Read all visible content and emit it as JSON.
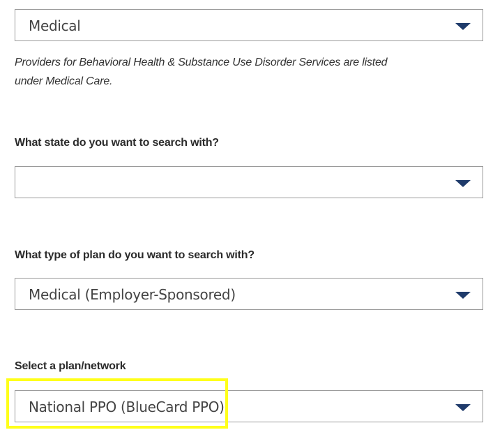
{
  "care_type": {
    "value": "Medical",
    "note": "Providers for Behavioral Health & Substance Use Disorder Services are listed under Medical Care."
  },
  "state": {
    "question": "What state do you want to search with?",
    "value": ""
  },
  "plan_type": {
    "question": "What type of plan do you want to search with?",
    "value": "Medical (Employer-Sponsored)"
  },
  "plan_network": {
    "question": "Select a plan/network",
    "value": "National PPO (BlueCard PPO)"
  },
  "colors": {
    "caret": "#1f3b6b",
    "highlight": "#ffff1a",
    "border": "#9a9a9a"
  },
  "icons": {
    "dropdown": "caret-down-icon"
  }
}
